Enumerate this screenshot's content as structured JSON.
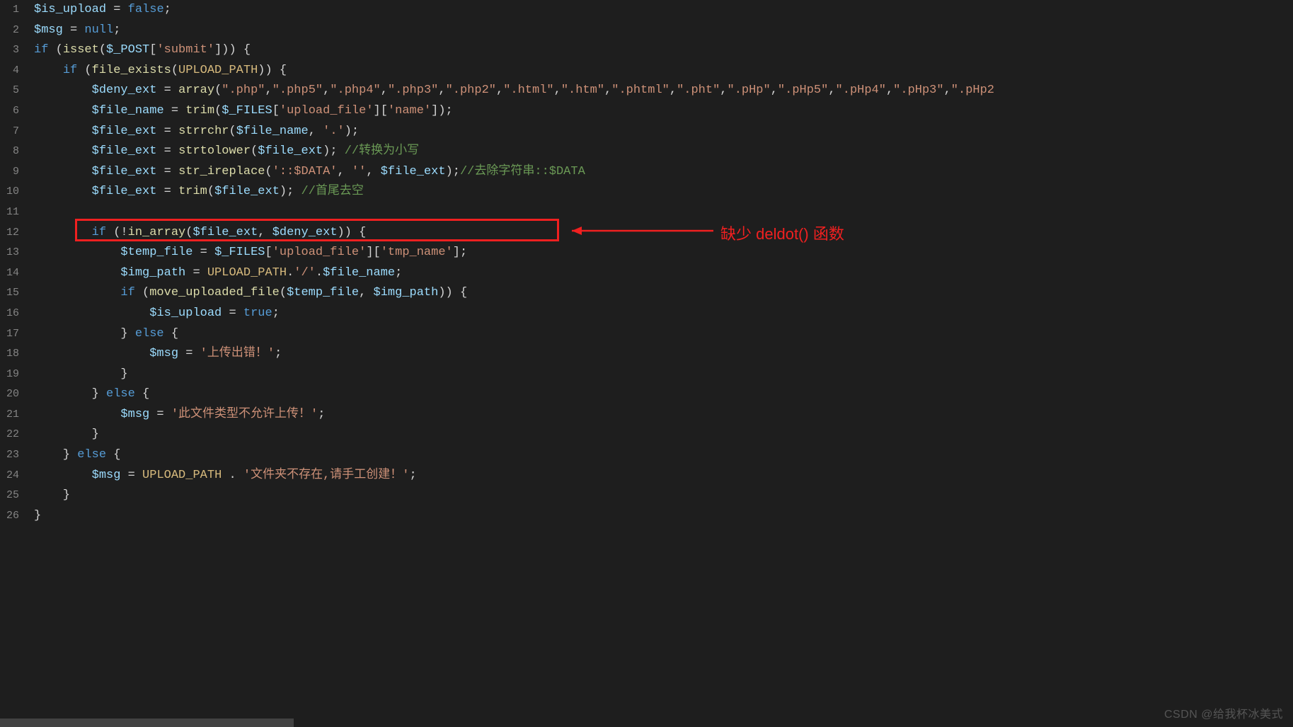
{
  "gutter": {
    "start": 1,
    "count": 26
  },
  "lines": {
    "l1": [
      {
        "c": "t-var",
        "t": "$is_upload"
      },
      {
        "c": "t-def",
        "t": " = "
      },
      {
        "c": "t-bool",
        "t": "false"
      },
      {
        "c": "t-def",
        "t": ";"
      }
    ],
    "l2": [
      {
        "c": "t-var",
        "t": "$msg"
      },
      {
        "c": "t-def",
        "t": " = "
      },
      {
        "c": "t-lit",
        "t": "null"
      },
      {
        "c": "t-def",
        "t": ";"
      }
    ],
    "l3": [
      {
        "c": "t-kw",
        "t": "if"
      },
      {
        "c": "t-def",
        "t": " ("
      },
      {
        "c": "t-fn",
        "t": "isset"
      },
      {
        "c": "t-def",
        "t": "("
      },
      {
        "c": "t-var",
        "t": "$_POST"
      },
      {
        "c": "t-def",
        "t": "["
      },
      {
        "c": "t-str",
        "t": "'submit'"
      },
      {
        "c": "t-def",
        "t": "])) {"
      }
    ],
    "l4": [
      {
        "c": "t-def",
        "t": "    "
      },
      {
        "c": "t-kw",
        "t": "if"
      },
      {
        "c": "t-def",
        "t": " ("
      },
      {
        "c": "t-fn",
        "t": "file_exists"
      },
      {
        "c": "t-def",
        "t": "("
      },
      {
        "c": "t-const",
        "t": "UPLOAD_PATH"
      },
      {
        "c": "t-def",
        "t": ")) {"
      }
    ],
    "l5": [
      {
        "c": "t-def",
        "t": "        "
      },
      {
        "c": "t-var",
        "t": "$deny_ext"
      },
      {
        "c": "t-def",
        "t": " = "
      },
      {
        "c": "t-fn",
        "t": "array"
      },
      {
        "c": "t-def",
        "t": "("
      },
      {
        "c": "t-str",
        "t": "\".php\""
      },
      {
        "c": "t-def",
        "t": ","
      },
      {
        "c": "t-str",
        "t": "\".php5\""
      },
      {
        "c": "t-def",
        "t": ","
      },
      {
        "c": "t-str",
        "t": "\".php4\""
      },
      {
        "c": "t-def",
        "t": ","
      },
      {
        "c": "t-str",
        "t": "\".php3\""
      },
      {
        "c": "t-def",
        "t": ","
      },
      {
        "c": "t-str",
        "t": "\".php2\""
      },
      {
        "c": "t-def",
        "t": ","
      },
      {
        "c": "t-str",
        "t": "\".html\""
      },
      {
        "c": "t-def",
        "t": ","
      },
      {
        "c": "t-str",
        "t": "\".htm\""
      },
      {
        "c": "t-def",
        "t": ","
      },
      {
        "c": "t-str",
        "t": "\".phtml\""
      },
      {
        "c": "t-def",
        "t": ","
      },
      {
        "c": "t-str",
        "t": "\".pht\""
      },
      {
        "c": "t-def",
        "t": ","
      },
      {
        "c": "t-str",
        "t": "\".pHp\""
      },
      {
        "c": "t-def",
        "t": ","
      },
      {
        "c": "t-str",
        "t": "\".pHp5\""
      },
      {
        "c": "t-def",
        "t": ","
      },
      {
        "c": "t-str",
        "t": "\".pHp4\""
      },
      {
        "c": "t-def",
        "t": ","
      },
      {
        "c": "t-str",
        "t": "\".pHp3\""
      },
      {
        "c": "t-def",
        "t": ","
      },
      {
        "c": "t-str",
        "t": "\".pHp2"
      }
    ],
    "l6": [
      {
        "c": "t-def",
        "t": "        "
      },
      {
        "c": "t-var",
        "t": "$file_name"
      },
      {
        "c": "t-def",
        "t": " = "
      },
      {
        "c": "t-fn",
        "t": "trim"
      },
      {
        "c": "t-def",
        "t": "("
      },
      {
        "c": "t-var",
        "t": "$_FILES"
      },
      {
        "c": "t-def",
        "t": "["
      },
      {
        "c": "t-str",
        "t": "'upload_file'"
      },
      {
        "c": "t-def",
        "t": "]["
      },
      {
        "c": "t-str",
        "t": "'name'"
      },
      {
        "c": "t-def",
        "t": "]);"
      }
    ],
    "l7": [
      {
        "c": "t-def",
        "t": "        "
      },
      {
        "c": "t-var",
        "t": "$file_ext"
      },
      {
        "c": "t-def",
        "t": " = "
      },
      {
        "c": "t-fn",
        "t": "strrchr"
      },
      {
        "c": "t-def",
        "t": "("
      },
      {
        "c": "t-var",
        "t": "$file_name"
      },
      {
        "c": "t-def",
        "t": ", "
      },
      {
        "c": "t-str",
        "t": "'.'"
      },
      {
        "c": "t-def",
        "t": ");"
      }
    ],
    "l8": [
      {
        "c": "t-def",
        "t": "        "
      },
      {
        "c": "t-var",
        "t": "$file_ext"
      },
      {
        "c": "t-def",
        "t": " = "
      },
      {
        "c": "t-fn",
        "t": "strtolower"
      },
      {
        "c": "t-def",
        "t": "("
      },
      {
        "c": "t-var",
        "t": "$file_ext"
      },
      {
        "c": "t-def",
        "t": "); "
      },
      {
        "c": "t-cmt",
        "t": "//转换为小写"
      }
    ],
    "l9": [
      {
        "c": "t-def",
        "t": "        "
      },
      {
        "c": "t-var",
        "t": "$file_ext"
      },
      {
        "c": "t-def",
        "t": " = "
      },
      {
        "c": "t-fn",
        "t": "str_ireplace"
      },
      {
        "c": "t-def",
        "t": "("
      },
      {
        "c": "t-str",
        "t": "'::$DATA'"
      },
      {
        "c": "t-def",
        "t": ", "
      },
      {
        "c": "t-str",
        "t": "''"
      },
      {
        "c": "t-def",
        "t": ", "
      },
      {
        "c": "t-var",
        "t": "$file_ext"
      },
      {
        "c": "t-def",
        "t": ");"
      },
      {
        "c": "t-cmt",
        "t": "//去除字符串::$DATA"
      }
    ],
    "l10": [
      {
        "c": "t-def",
        "t": "        "
      },
      {
        "c": "t-var",
        "t": "$file_ext"
      },
      {
        "c": "t-def",
        "t": " = "
      },
      {
        "c": "t-fn",
        "t": "trim"
      },
      {
        "c": "t-def",
        "t": "("
      },
      {
        "c": "t-var",
        "t": "$file_ext"
      },
      {
        "c": "t-def",
        "t": "); "
      },
      {
        "c": "t-cmt",
        "t": "//首尾去空"
      }
    ],
    "l11": [
      {
        "c": "t-def",
        "t": ""
      }
    ],
    "l12": [
      {
        "c": "t-def",
        "t": "        "
      },
      {
        "c": "t-kw",
        "t": "if"
      },
      {
        "c": "t-def",
        "t": " (!"
      },
      {
        "c": "t-fn",
        "t": "in_array"
      },
      {
        "c": "t-def",
        "t": "("
      },
      {
        "c": "t-var",
        "t": "$file_ext"
      },
      {
        "c": "t-def",
        "t": ", "
      },
      {
        "c": "t-var",
        "t": "$deny_ext"
      },
      {
        "c": "t-def",
        "t": ")) {"
      }
    ],
    "l13": [
      {
        "c": "t-def",
        "t": "            "
      },
      {
        "c": "t-var",
        "t": "$temp_file"
      },
      {
        "c": "t-def",
        "t": " = "
      },
      {
        "c": "t-var",
        "t": "$_FILES"
      },
      {
        "c": "t-def",
        "t": "["
      },
      {
        "c": "t-str",
        "t": "'upload_file'"
      },
      {
        "c": "t-def",
        "t": "]["
      },
      {
        "c": "t-str",
        "t": "'tmp_name'"
      },
      {
        "c": "t-def",
        "t": "];"
      }
    ],
    "l14": [
      {
        "c": "t-def",
        "t": "            "
      },
      {
        "c": "t-var",
        "t": "$img_path"
      },
      {
        "c": "t-def",
        "t": " = "
      },
      {
        "c": "t-const",
        "t": "UPLOAD_PATH"
      },
      {
        "c": "t-def",
        "t": "."
      },
      {
        "c": "t-str",
        "t": "'/'"
      },
      {
        "c": "t-def",
        "t": "."
      },
      {
        "c": "t-var",
        "t": "$file_name"
      },
      {
        "c": "t-def",
        "t": ";"
      }
    ],
    "l15": [
      {
        "c": "t-def",
        "t": "            "
      },
      {
        "c": "t-kw",
        "t": "if"
      },
      {
        "c": "t-def",
        "t": " ("
      },
      {
        "c": "t-fn",
        "t": "move_uploaded_file"
      },
      {
        "c": "t-def",
        "t": "("
      },
      {
        "c": "t-var",
        "t": "$temp_file"
      },
      {
        "c": "t-def",
        "t": ", "
      },
      {
        "c": "t-var",
        "t": "$img_path"
      },
      {
        "c": "t-def",
        "t": ")) {"
      }
    ],
    "l16": [
      {
        "c": "t-def",
        "t": "                "
      },
      {
        "c": "t-var",
        "t": "$is_upload"
      },
      {
        "c": "t-def",
        "t": " = "
      },
      {
        "c": "t-bool",
        "t": "true"
      },
      {
        "c": "t-def",
        "t": ";"
      }
    ],
    "l17": [
      {
        "c": "t-def",
        "t": "            } "
      },
      {
        "c": "t-kw",
        "t": "else"
      },
      {
        "c": "t-def",
        "t": " {"
      }
    ],
    "l18": [
      {
        "c": "t-def",
        "t": "                "
      },
      {
        "c": "t-var",
        "t": "$msg"
      },
      {
        "c": "t-def",
        "t": " = "
      },
      {
        "c": "t-str",
        "t": "'上传出错！'"
      },
      {
        "c": "t-def",
        "t": ";"
      }
    ],
    "l19": [
      {
        "c": "t-def",
        "t": "            }"
      }
    ],
    "l20": [
      {
        "c": "t-def",
        "t": "        } "
      },
      {
        "c": "t-kw",
        "t": "else"
      },
      {
        "c": "t-def",
        "t": " {"
      }
    ],
    "l21": [
      {
        "c": "t-def",
        "t": "            "
      },
      {
        "c": "t-var",
        "t": "$msg"
      },
      {
        "c": "t-def",
        "t": " = "
      },
      {
        "c": "t-str",
        "t": "'此文件类型不允许上传！'"
      },
      {
        "c": "t-def",
        "t": ";"
      }
    ],
    "l22": [
      {
        "c": "t-def",
        "t": "        }"
      }
    ],
    "l23": [
      {
        "c": "t-def",
        "t": "    } "
      },
      {
        "c": "t-kw",
        "t": "else"
      },
      {
        "c": "t-def",
        "t": " {"
      }
    ],
    "l24": [
      {
        "c": "t-def",
        "t": "        "
      },
      {
        "c": "t-var",
        "t": "$msg"
      },
      {
        "c": "t-def",
        "t": " = "
      },
      {
        "c": "t-const",
        "t": "UPLOAD_PATH"
      },
      {
        "c": "t-def",
        "t": " . "
      },
      {
        "c": "t-str",
        "t": "'文件夹不存在,请手工创建！'"
      },
      {
        "c": "t-def",
        "t": ";"
      }
    ],
    "l25": [
      {
        "c": "t-def",
        "t": "    }"
      }
    ],
    "l26": [
      {
        "c": "t-def",
        "t": "}"
      }
    ]
  },
  "annotation": {
    "text": "缺少 deldot() 函数"
  },
  "watermark": {
    "text": "CSDN @给我杯冰美式"
  }
}
